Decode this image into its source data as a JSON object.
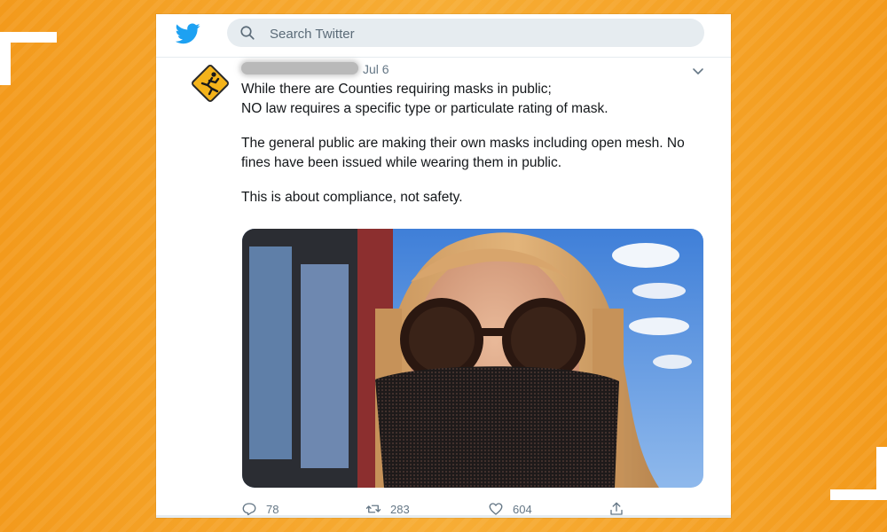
{
  "colors": {
    "background": "#f6a52a",
    "twitter_blue": "#1da1f2",
    "text": "#14171a",
    "muted": "#657786"
  },
  "topbar": {
    "logo_icon": "twitter-bird-icon",
    "search": {
      "placeholder": "Search Twitter",
      "value": ""
    }
  },
  "tweet": {
    "avatar_icon": "running-man-warning-sign-icon",
    "author_name": "",
    "date": "Jul 6",
    "paragraphs": [
      "While there are Counties requiring masks in public; NO law requires a specific type or particulate rating of mask.",
      "The general public are making their own masks including open mesh.  No fines have been issued while wearing them in public.",
      "This is about compliance, not safety."
    ],
    "line_1": "While there are Counties requiring masks in public;",
    "line_2": "NO law requires a specific type or particulate rating of mask.",
    "para_2_line_1": "The general public are making their own masks including open mesh.  No",
    "para_2_line_2": "fines have been issued while wearing them in public.",
    "para_3": "This is about compliance, not safety.",
    "media": {
      "icon": "photo-selfie-mesh-mask"
    },
    "actions": {
      "reply": {
        "icon": "reply-icon",
        "count": "78"
      },
      "retweet": {
        "icon": "retweet-icon",
        "count": "283"
      },
      "like": {
        "icon": "heart-icon",
        "count": "604"
      },
      "share": {
        "icon": "share-icon"
      }
    }
  }
}
